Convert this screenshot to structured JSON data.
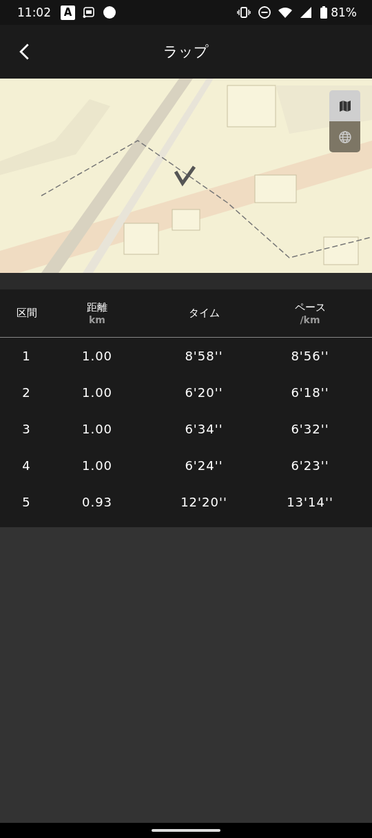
{
  "status_bar": {
    "time": "11:02",
    "notifications": [
      {
        "kind": "letter",
        "text": "A"
      },
      {
        "kind": "pay"
      },
      {
        "kind": "dot"
      }
    ],
    "battery": "81%"
  },
  "header": {
    "title": "ラップ"
  },
  "map": {
    "kind": "picture",
    "layers": [
      {
        "kind": "map",
        "selected": true
      },
      {
        "kind": "globe",
        "selected": false
      }
    ]
  },
  "table": {
    "columns": [
      {
        "label": "区間"
      },
      {
        "label": "距離",
        "unit": "km"
      },
      {
        "label": "タイム"
      },
      {
        "label": "ペース",
        "unit": "/km"
      }
    ],
    "rows": [
      [
        "1",
        "1.00",
        "8'58''",
        "8'56''"
      ],
      [
        "2",
        "1.00",
        "6'20''",
        "6'18''"
      ],
      [
        "3",
        "1.00",
        "6'34''",
        "6'32''"
      ],
      [
        "4",
        "1.00",
        "6'24''",
        "6'23''"
      ],
      [
        "5",
        "0.93",
        "12'20''",
        "13'14''"
      ]
    ]
  }
}
